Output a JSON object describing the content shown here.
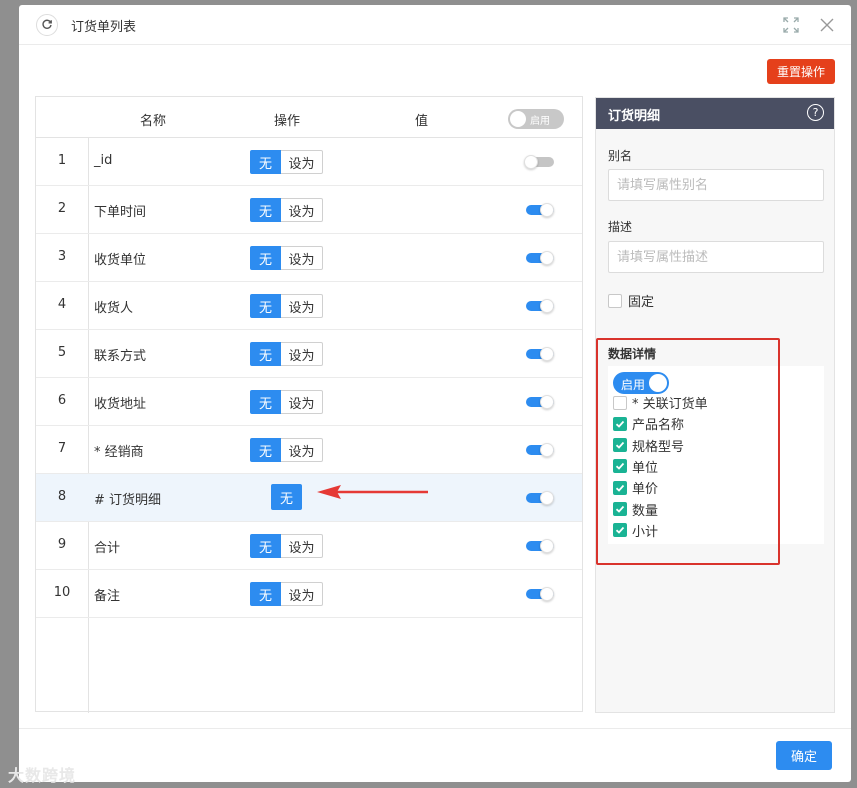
{
  "window": {
    "title": "订货单列表"
  },
  "toolbar": {
    "reset_label": "重置操作"
  },
  "table": {
    "headers": {
      "name": "名称",
      "action": "操作",
      "value": "值"
    },
    "header_toggle_label": "启用",
    "none_label": "无",
    "setas_label": "设为",
    "rows": [
      {
        "index": "1",
        "name": "_id",
        "toggle_on": false,
        "has_setas": true
      },
      {
        "index": "2",
        "name": "下单时间",
        "toggle_on": true,
        "has_setas": true
      },
      {
        "index": "3",
        "name": "收货单位",
        "toggle_on": true,
        "has_setas": true
      },
      {
        "index": "4",
        "name": "收货人",
        "toggle_on": true,
        "has_setas": true
      },
      {
        "index": "5",
        "name": "联系方式",
        "toggle_on": true,
        "has_setas": true
      },
      {
        "index": "6",
        "name": "收货地址",
        "toggle_on": true,
        "has_setas": true
      },
      {
        "index": "7",
        "name": "* 经销商",
        "toggle_on": true,
        "has_setas": true
      },
      {
        "index": "8",
        "name": "# 订货明细",
        "toggle_on": true,
        "has_setas": false
      },
      {
        "index": "9",
        "name": "合计",
        "toggle_on": true,
        "has_setas": true
      },
      {
        "index": "10",
        "name": "备注",
        "toggle_on": true,
        "has_setas": true
      }
    ]
  },
  "panel": {
    "title": "订货明细",
    "alias_label": "别名",
    "alias_placeholder": "请填写属性别名",
    "desc_label": "描述",
    "desc_placeholder": "请填写属性描述",
    "fixed_label": "固定",
    "data_detail_label": "数据详情",
    "enable_label": "启用",
    "fields": [
      {
        "label": "* 关联订货单",
        "checked": false
      },
      {
        "label": "产品名称",
        "checked": true
      },
      {
        "label": "规格型号",
        "checked": true
      },
      {
        "label": "单位",
        "checked": true
      },
      {
        "label": "单价",
        "checked": true
      },
      {
        "label": "数量",
        "checked": true
      },
      {
        "label": "小计",
        "checked": true
      }
    ]
  },
  "footer": {
    "ok_label": "确定"
  },
  "watermark": "大数跨境",
  "colors": {
    "primary": "#2d8cf0",
    "danger": "#e5401b",
    "check": "#1ab394",
    "panel_header": "#4a4f63"
  }
}
